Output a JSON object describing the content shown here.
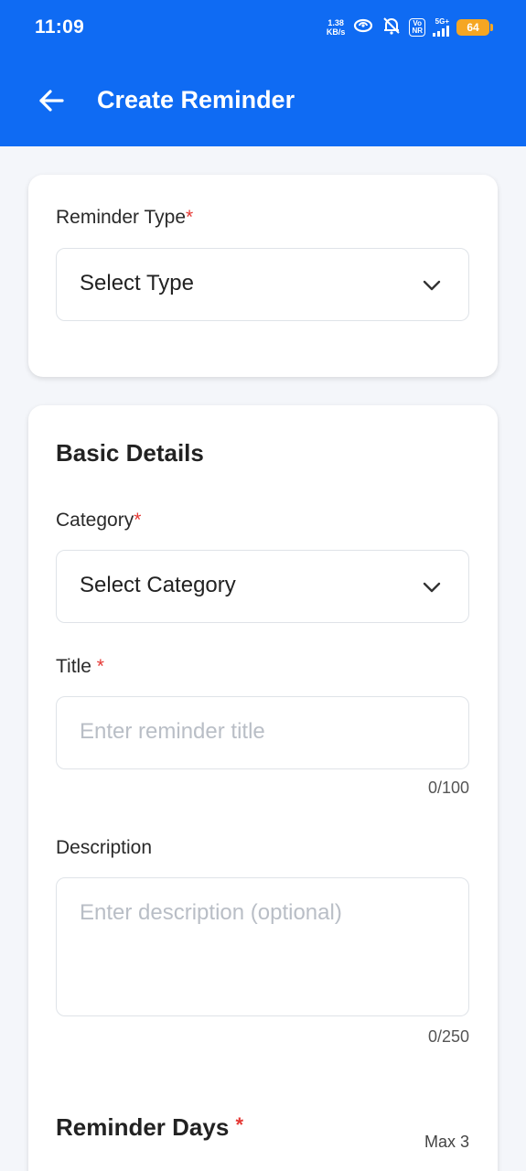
{
  "status_bar": {
    "time": "11:09",
    "net_speed_value": "1.38",
    "net_speed_unit": "KB/s",
    "volte_line1": "Vo",
    "volte_line2": "NR",
    "network_type": "5G+",
    "battery": "64",
    "icons": [
      "hotspot-icon",
      "mute-notifications-icon",
      "volte-icon",
      "signal-icon",
      "battery-icon"
    ]
  },
  "header": {
    "title": "Create Reminder",
    "back_icon": "arrow-left-icon"
  },
  "reminder_type": {
    "label": "Reminder Type",
    "required_mark": "*",
    "selected": "Select Type"
  },
  "basic_details": {
    "section_title": "Basic Details",
    "category": {
      "label": "Category",
      "required_mark": "*",
      "selected": "Select Category"
    },
    "title_field": {
      "label": "Title",
      "required_mark": "*",
      "placeholder": "Enter reminder title",
      "counter": "0/100"
    },
    "description": {
      "label": "Description",
      "placeholder": "Enter description (optional)",
      "counter": "0/250"
    }
  },
  "reminder_days": {
    "title": "Reminder Days",
    "required_mark": "*",
    "max_label": "Max 3"
  },
  "colors": {
    "primary": "#0f6bf3",
    "required": "#e53935",
    "battery": "#f5a623"
  }
}
